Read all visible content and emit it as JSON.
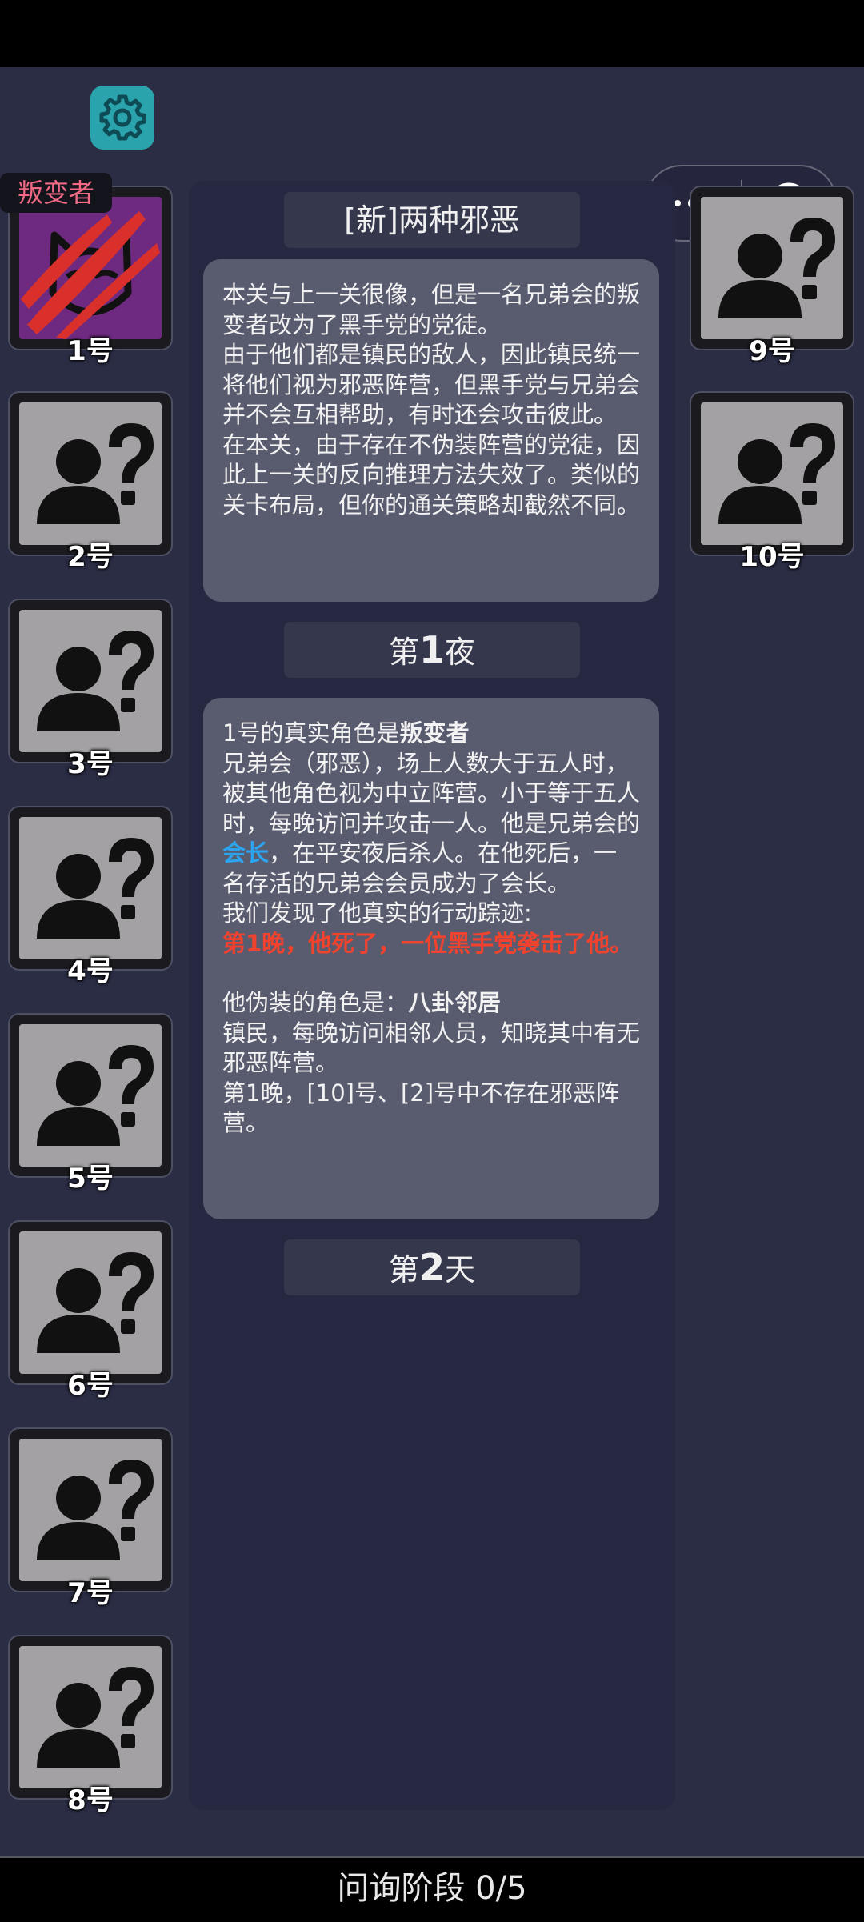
{
  "settings": {
    "icon": "gear-icon",
    "color": "#2aa3ac"
  },
  "capsule": {
    "more_icon": "more-dots-icon",
    "close_icon": "target-close-icon"
  },
  "players": [
    {
      "label": "1号",
      "tag": "叛变者",
      "state": "revealed",
      "icon": "claw-mask-icon"
    },
    {
      "label": "2号",
      "state": "unknown",
      "icon": "unknown-person-icon"
    },
    {
      "label": "3号",
      "state": "unknown",
      "icon": "unknown-person-icon"
    },
    {
      "label": "4号",
      "state": "unknown",
      "icon": "unknown-person-icon"
    },
    {
      "label": "5号",
      "state": "unknown",
      "icon": "unknown-person-icon"
    },
    {
      "label": "6号",
      "state": "unknown",
      "icon": "unknown-person-icon"
    },
    {
      "label": "7号",
      "state": "unknown",
      "icon": "unknown-person-icon"
    },
    {
      "label": "8号",
      "state": "unknown",
      "icon": "unknown-person-icon"
    },
    {
      "label": "9号",
      "state": "unknown",
      "icon": "unknown-person-icon"
    },
    {
      "label": "10号",
      "state": "unknown",
      "icon": "unknown-person-icon"
    }
  ],
  "log": {
    "level_title": "[新]两种邪恶",
    "intro": [
      "本关与上一关很像，但是一名兄弟会的叛变者改为了黑手党的党徒。",
      "由于他们都是镇民的敌人，因此镇民统一将他们视为邪恶阵营，但黑手党与兄弟会并不会互相帮助，有时还会攻击彼此。",
      "在本关，由于存在不伪装阵营的党徒，因此上一关的反向推理方法失效了。类似的关卡布局，但你的通关策略却截然不同。"
    ],
    "night1": {
      "prefix": "第",
      "num": "1",
      "suffix": "夜"
    },
    "reveal": {
      "role_prefix": "1号的真实角色是",
      "role_name": "叛变者",
      "desc_a": "兄弟会（邪恶），场上人数大于五人时，被其他角色视为中立阵营。小于等于五人时，每晚访问并攻击一人。他是兄弟会的",
      "leader": "会长",
      "desc_b": "，在平安夜后杀人。在他死后，一名存活的兄弟会会员成为了会长。",
      "trace_label": "我们发现了他真实的行动踪迹:",
      "trace": "第1晚，他死了，一位黑手党袭击了他。",
      "disguise_prefix": "他伪装的角色是：",
      "disguise_name": "八卦邻居",
      "disguise_desc": "镇民，每晚访问相邻人员，知晓其中有无邪恶阵营。",
      "disguise_result": "第1晚，[10]号、[2]号中不存在邪恶阵营。"
    },
    "day2": {
      "prefix": "第",
      "num": "2",
      "suffix": "天"
    }
  },
  "phase": {
    "label": "问询阶段 0/5"
  }
}
